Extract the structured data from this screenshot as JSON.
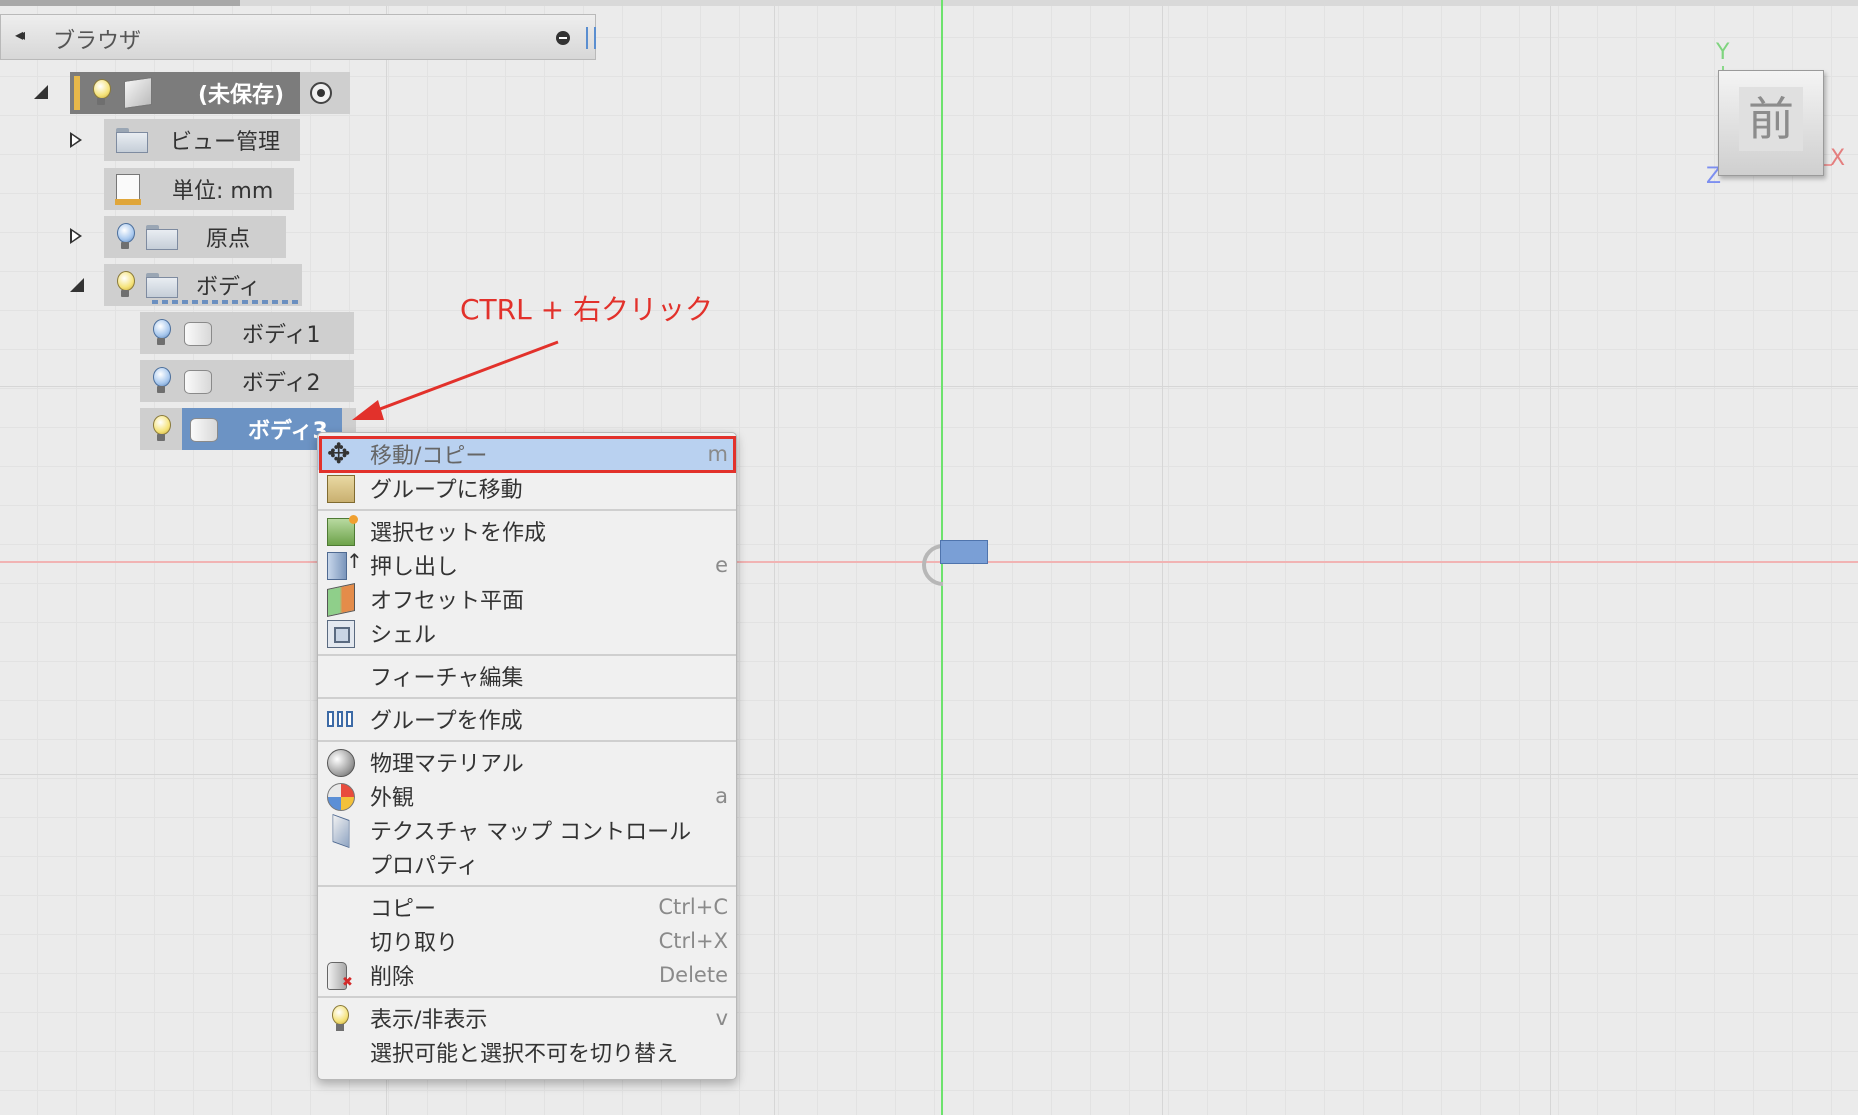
{
  "browser": {
    "title": "ブラウザ",
    "collapse_glyph": "◂◂",
    "root": {
      "label": "(未保存)"
    },
    "nodes": {
      "view_management": "ビュー管理",
      "units": "単位: mm",
      "origin": "原点",
      "bodies": "ボディ",
      "body1": "ボディ1",
      "body2": "ボディ2",
      "body3": "ボディ3"
    }
  },
  "annotation": {
    "text": "CTRL + 右クリック",
    "color": "#e2312b"
  },
  "context_menu": {
    "items": {
      "move_copy": {
        "label": "移動/コピー",
        "shortcut": "m",
        "icon": "move-icon"
      },
      "move_to_group": {
        "label": "グループに移動",
        "icon": "folder-move-icon"
      },
      "create_selection_set": {
        "label": "選択セットを作成",
        "icon": "selection-set-icon"
      },
      "extrude": {
        "label": "押し出し",
        "shortcut": "e",
        "icon": "extrude-icon"
      },
      "offset_plane": {
        "label": "オフセット平面",
        "icon": "offset-plane-icon"
      },
      "shell": {
        "label": "シェル",
        "icon": "shell-icon"
      },
      "edit_feature": {
        "label": "フィーチャ編集"
      },
      "create_component": {
        "label": "グループを作成",
        "icon": "component-icon"
      },
      "physical_material": {
        "label": "物理マテリアル",
        "icon": "material-icon"
      },
      "appearance": {
        "label": "外観",
        "shortcut": "a",
        "icon": "appearance-icon"
      },
      "texture_map": {
        "label": "テクスチャ マップ コントロール",
        "icon": "texture-map-icon"
      },
      "properties": {
        "label": "プロパティ"
      },
      "copy": {
        "label": "コピー",
        "shortcut": "Ctrl+C"
      },
      "cut": {
        "label": "切り取り",
        "shortcut": "Ctrl+X"
      },
      "delete": {
        "label": "削除",
        "shortcut": "Delete",
        "icon": "delete-icon"
      },
      "show_hide": {
        "label": "表示/非表示",
        "shortcut": "v",
        "icon": "lightbulb-icon"
      },
      "toggle_selectable": {
        "label": "選択可能と選択不可を切り替え"
      }
    }
  },
  "viewcube": {
    "face_label": "前",
    "axis_y": "Y",
    "axis_x": "X",
    "axis_z": "Z"
  },
  "colors": {
    "highlight": "#b9d1f0",
    "selected_node": "#6c93c4",
    "x_axis": "#f1b3b3",
    "y_axis": "#6de26d"
  }
}
